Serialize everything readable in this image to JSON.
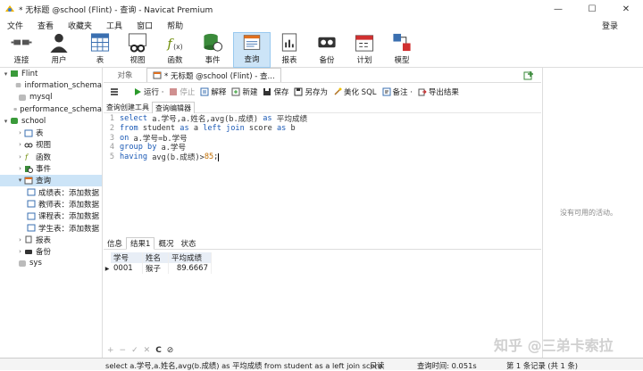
{
  "window": {
    "title": "* 无标题 @school (Flint) - 查询 - Navicat Premium",
    "minimize": "—",
    "maximize": "☐",
    "close": "✕"
  },
  "menu": [
    "文件",
    "查看",
    "收藏夹",
    "工具",
    "窗口",
    "帮助"
  ],
  "login": "登录",
  "toolbar": [
    {
      "label": "连接",
      "icon": "plug-icon"
    },
    {
      "label": "用户",
      "icon": "user-icon"
    },
    {
      "label": "表",
      "icon": "table-icon"
    },
    {
      "label": "视图",
      "icon": "view-icon"
    },
    {
      "label": "函数",
      "icon": "function-icon"
    },
    {
      "label": "事件",
      "icon": "event-icon"
    },
    {
      "label": "查询",
      "icon": "query-icon"
    },
    {
      "label": "报表",
      "icon": "report-icon"
    },
    {
      "label": "备份",
      "icon": "backup-icon"
    },
    {
      "label": "计划",
      "icon": "schedule-icon"
    },
    {
      "label": "模型",
      "icon": "model-icon"
    }
  ],
  "tree": [
    {
      "label": "Flint",
      "level": 0,
      "arrow": "▾",
      "icon": "connection-icon"
    },
    {
      "label": "information_schema",
      "level": 1,
      "arrow": "",
      "icon": "db-icon"
    },
    {
      "label": "mysql",
      "level": 1,
      "arrow": "",
      "icon": "db-icon"
    },
    {
      "label": "performance_schema",
      "level": 1,
      "arrow": "",
      "icon": "db-icon"
    },
    {
      "label": "school",
      "level": 1,
      "arrow": "▾",
      "icon": "db-active-icon"
    },
    {
      "label": "表",
      "level": 2,
      "arrow": "›",
      "icon": "table-icon"
    },
    {
      "label": "视图",
      "level": 2,
      "arrow": "›",
      "icon": "view-icon"
    },
    {
      "label": "函数",
      "level": 2,
      "arrow": "›",
      "icon": "function-icon"
    },
    {
      "label": "事件",
      "level": 2,
      "arrow": "›",
      "icon": "event-icon"
    },
    {
      "label": "查询",
      "level": 2,
      "arrow": "▾",
      "icon": "query-icon",
      "selected": true
    },
    {
      "label": "成绩表：添加数据",
      "level": 3,
      "arrow": "",
      "icon": "query-item-icon"
    },
    {
      "label": "教师表：添加数据",
      "level": 3,
      "arrow": "",
      "icon": "query-item-icon"
    },
    {
      "label": "课程表：添加数据",
      "level": 3,
      "arrow": "",
      "icon": "query-item-icon"
    },
    {
      "label": "学生表：添加数据",
      "level": 3,
      "arrow": "",
      "icon": "query-item-icon"
    },
    {
      "label": "报表",
      "level": 2,
      "arrow": "›",
      "icon": "report-icon"
    },
    {
      "label": "备份",
      "level": 2,
      "arrow": "›",
      "icon": "backup-icon"
    },
    {
      "label": "sys",
      "level": 1,
      "arrow": "",
      "icon": "db-icon"
    }
  ],
  "tabs": {
    "objects": "对象",
    "query": "* 无标题 @school (Flint) - 查..."
  },
  "qtoolbar": {
    "run": "运行 ·",
    "stop": "停止",
    "explain": "解释",
    "new": "新建",
    "save": "保存",
    "saveas": "另存为",
    "beautify": "美化 SQL",
    "comment": "备注 ·",
    "export": "导出结果"
  },
  "subtabs": {
    "builder": "查询创建工具",
    "editor": "查询编辑器"
  },
  "sql_lines": [
    [
      {
        "t": "select ",
        "c": "kw"
      },
      {
        "t": "a.学号,a.姓名,avg(b.成绩) ",
        "c": "tx"
      },
      {
        "t": "as",
        "c": "kw"
      },
      {
        "t": " 平均成绩",
        "c": "tx"
      }
    ],
    [
      {
        "t": "from",
        "c": "kw"
      },
      {
        "t": " student ",
        "c": "tx"
      },
      {
        "t": "as",
        "c": "kw"
      },
      {
        "t": " a ",
        "c": "tx"
      },
      {
        "t": "left join",
        "c": "kw"
      },
      {
        "t": " score ",
        "c": "tx"
      },
      {
        "t": "as",
        "c": "kw"
      },
      {
        "t": " b",
        "c": "tx"
      }
    ],
    [
      {
        "t": "on",
        "c": "kw"
      },
      {
        "t": " a.学号=b.学号",
        "c": "tx"
      }
    ],
    [
      {
        "t": "group by",
        "c": "kw"
      },
      {
        "t": " a.学号",
        "c": "tx"
      }
    ],
    [
      {
        "t": "having",
        "c": "kw"
      },
      {
        "t": " avg(b.成绩)>",
        "c": "tx"
      },
      {
        "t": "85",
        "c": "num"
      },
      {
        "t": ";",
        "c": "tx"
      }
    ]
  ],
  "result_tabs": [
    "信息",
    "结果1",
    "概况",
    "状态"
  ],
  "columns": [
    "学号",
    "姓名",
    "平均成绩"
  ],
  "rows": [
    [
      "0001",
      "猴子",
      "89.6667"
    ]
  ],
  "right_empty": "没有可用的活动。",
  "bottom_tools": [
    "+",
    "−",
    "✓",
    "✕",
    "C",
    "⊘"
  ],
  "watermark": "知乎 @三弟卡索拉",
  "status": {
    "sql": "select a.学号,a.姓名,avg(b.成绩) as 平均成绩 from student as a left join score",
    "mode": "只读",
    "time": "查询时间: 0.051s",
    "record": "第 1 条记录 (共 1 条)"
  }
}
